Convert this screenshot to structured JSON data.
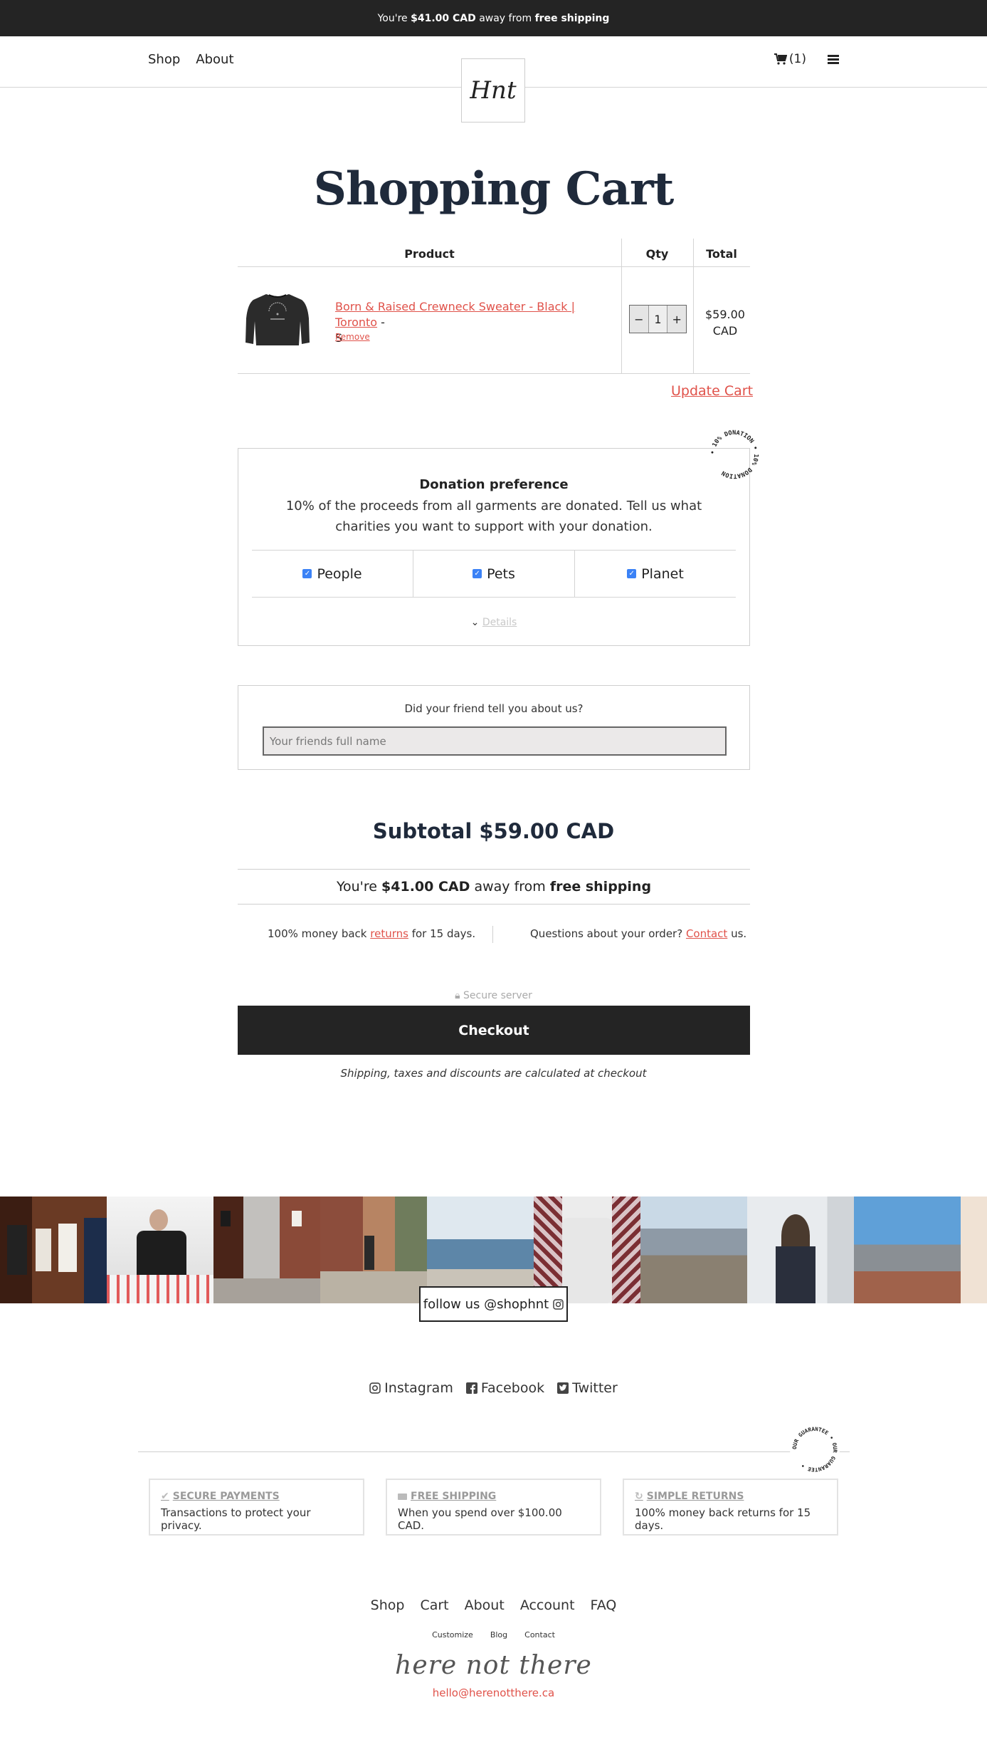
{
  "topbar": {
    "prefix": "You're ",
    "amount": "$41.00 CAD",
    "middle": " away from ",
    "bold_end": "free shipping"
  },
  "nav": {
    "shop": "Shop",
    "about": "About",
    "cart_count": "(1)",
    "logo": "Hnt"
  },
  "page_title": "Shopping Cart",
  "table": {
    "headers": {
      "product": "Product",
      "qty": "Qty",
      "total": "Total"
    },
    "item": {
      "name": "Born & Raised Crewneck Sweater - Black | Toronto",
      "dash": " -",
      "size": "S",
      "remove": "Remove",
      "minus": "−",
      "qty": "1",
      "plus": "+",
      "price_line1": "$59.00",
      "price_line2": "CAD"
    }
  },
  "update_cart": "Update Cart",
  "donation": {
    "badge_text": "• 10% DONATION • 10% DONATION",
    "heading": "Donation preference",
    "text": "10% of the proceeds from all garments are donated. Tell us what charities you want to support with your donation.",
    "options": [
      "People",
      "Pets",
      "Planet"
    ],
    "details": "Details"
  },
  "friend": {
    "question": "Did your friend tell you about us?",
    "placeholder": "Your friends full name"
  },
  "subtotal": "Subtotal $59.00 CAD",
  "shipping_notice": {
    "prefix": "You're ",
    "amount": "$41.00 CAD",
    "middle": " away from ",
    "bold_end": "free shipping"
  },
  "guarantee": {
    "returns_prefix": "100% money back ",
    "returns_link": "returns",
    "returns_suffix": " for 15 days.",
    "questions_prefix": "Questions about your order? ",
    "contact_link": "Contact",
    "contact_suffix": " us."
  },
  "secure_server": "Secure server",
  "checkout": "Checkout",
  "ship_note": "Shipping, taxes and discounts are calculated at checkout",
  "follow": "follow us @shophnt",
  "social": [
    "Instagram",
    "Facebook",
    "Twitter"
  ],
  "guarantee_badge": "OUR GUARANTEE • OUR GUARANTEE •",
  "cards": [
    {
      "title": "SECURE PAYMENTS",
      "desc": "Transactions to protect your privacy.",
      "icon": "check-icon"
    },
    {
      "title": "FREE SHIPPING",
      "desc": "When you spend over $100.00 CAD.",
      "icon": "truck-icon"
    },
    {
      "title": "SIMPLE RETURNS",
      "desc": "100% money back returns for 15 days.",
      "icon": "refresh-icon"
    }
  ],
  "footer_nav": [
    "Shop",
    "Cart",
    "About",
    "Account",
    "FAQ"
  ],
  "footer_small": [
    "Customize",
    "Blog",
    "Contact"
  ],
  "signature": "here not there",
  "email": "hello@herenotthere.ca",
  "colors": {
    "accent": "#e0524a",
    "dark": "#242424",
    "title": "#1f2a3b",
    "checkbox": "#3b82f6"
  }
}
